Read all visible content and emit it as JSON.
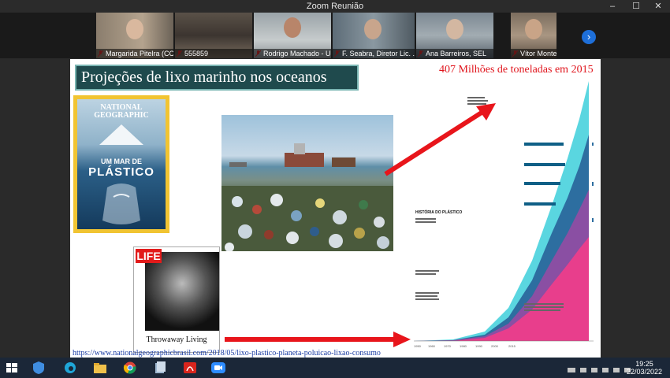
{
  "window": {
    "title": "Zoom Reunião"
  },
  "participants": [
    {
      "name": "Margarida Pitelra (CC..."
    },
    {
      "name": "555859"
    },
    {
      "name": "Rodrigo Machado - UN..."
    },
    {
      "name": "F. Seabra, Diretor Lic. ..."
    },
    {
      "name": "Ana Barreiros, SEL"
    },
    {
      "name": "Vítor Monteiro..."
    }
  ],
  "slide": {
    "title": "Projeções de lixo marinho nos oceanos",
    "headline": "407  Milhões de toneladas em 2015",
    "natgeo": {
      "logo_line1": "NATIONAL",
      "logo_line2": "GEOGRAPHIC",
      "headline_line1": "UM MAR DE",
      "headline_line2": "PLÁSTICO"
    },
    "life": {
      "logo": "LIFE",
      "caption": "Throwaway  Living"
    },
    "source_url": "https://www.nationalgeographicbrasil.com/2018/05/lixo-plastico-planeta-poluicao-lixao-consumo",
    "infographic": {
      "section_title": "HISTÓRIA DO PLÁSTICO",
      "years": [
        "1950",
        "1960",
        "1970",
        "1980",
        "1990",
        "2000",
        "2015"
      ]
    }
  },
  "taskbar": {
    "time": "19:25",
    "date": "22/03/2022"
  },
  "colors": {
    "title_bg": "#1f4a4d",
    "headline": "#e0141c",
    "arrow": "#e8151b",
    "link": "#1b3da3",
    "zoom_blue": "#1e6fd9"
  }
}
